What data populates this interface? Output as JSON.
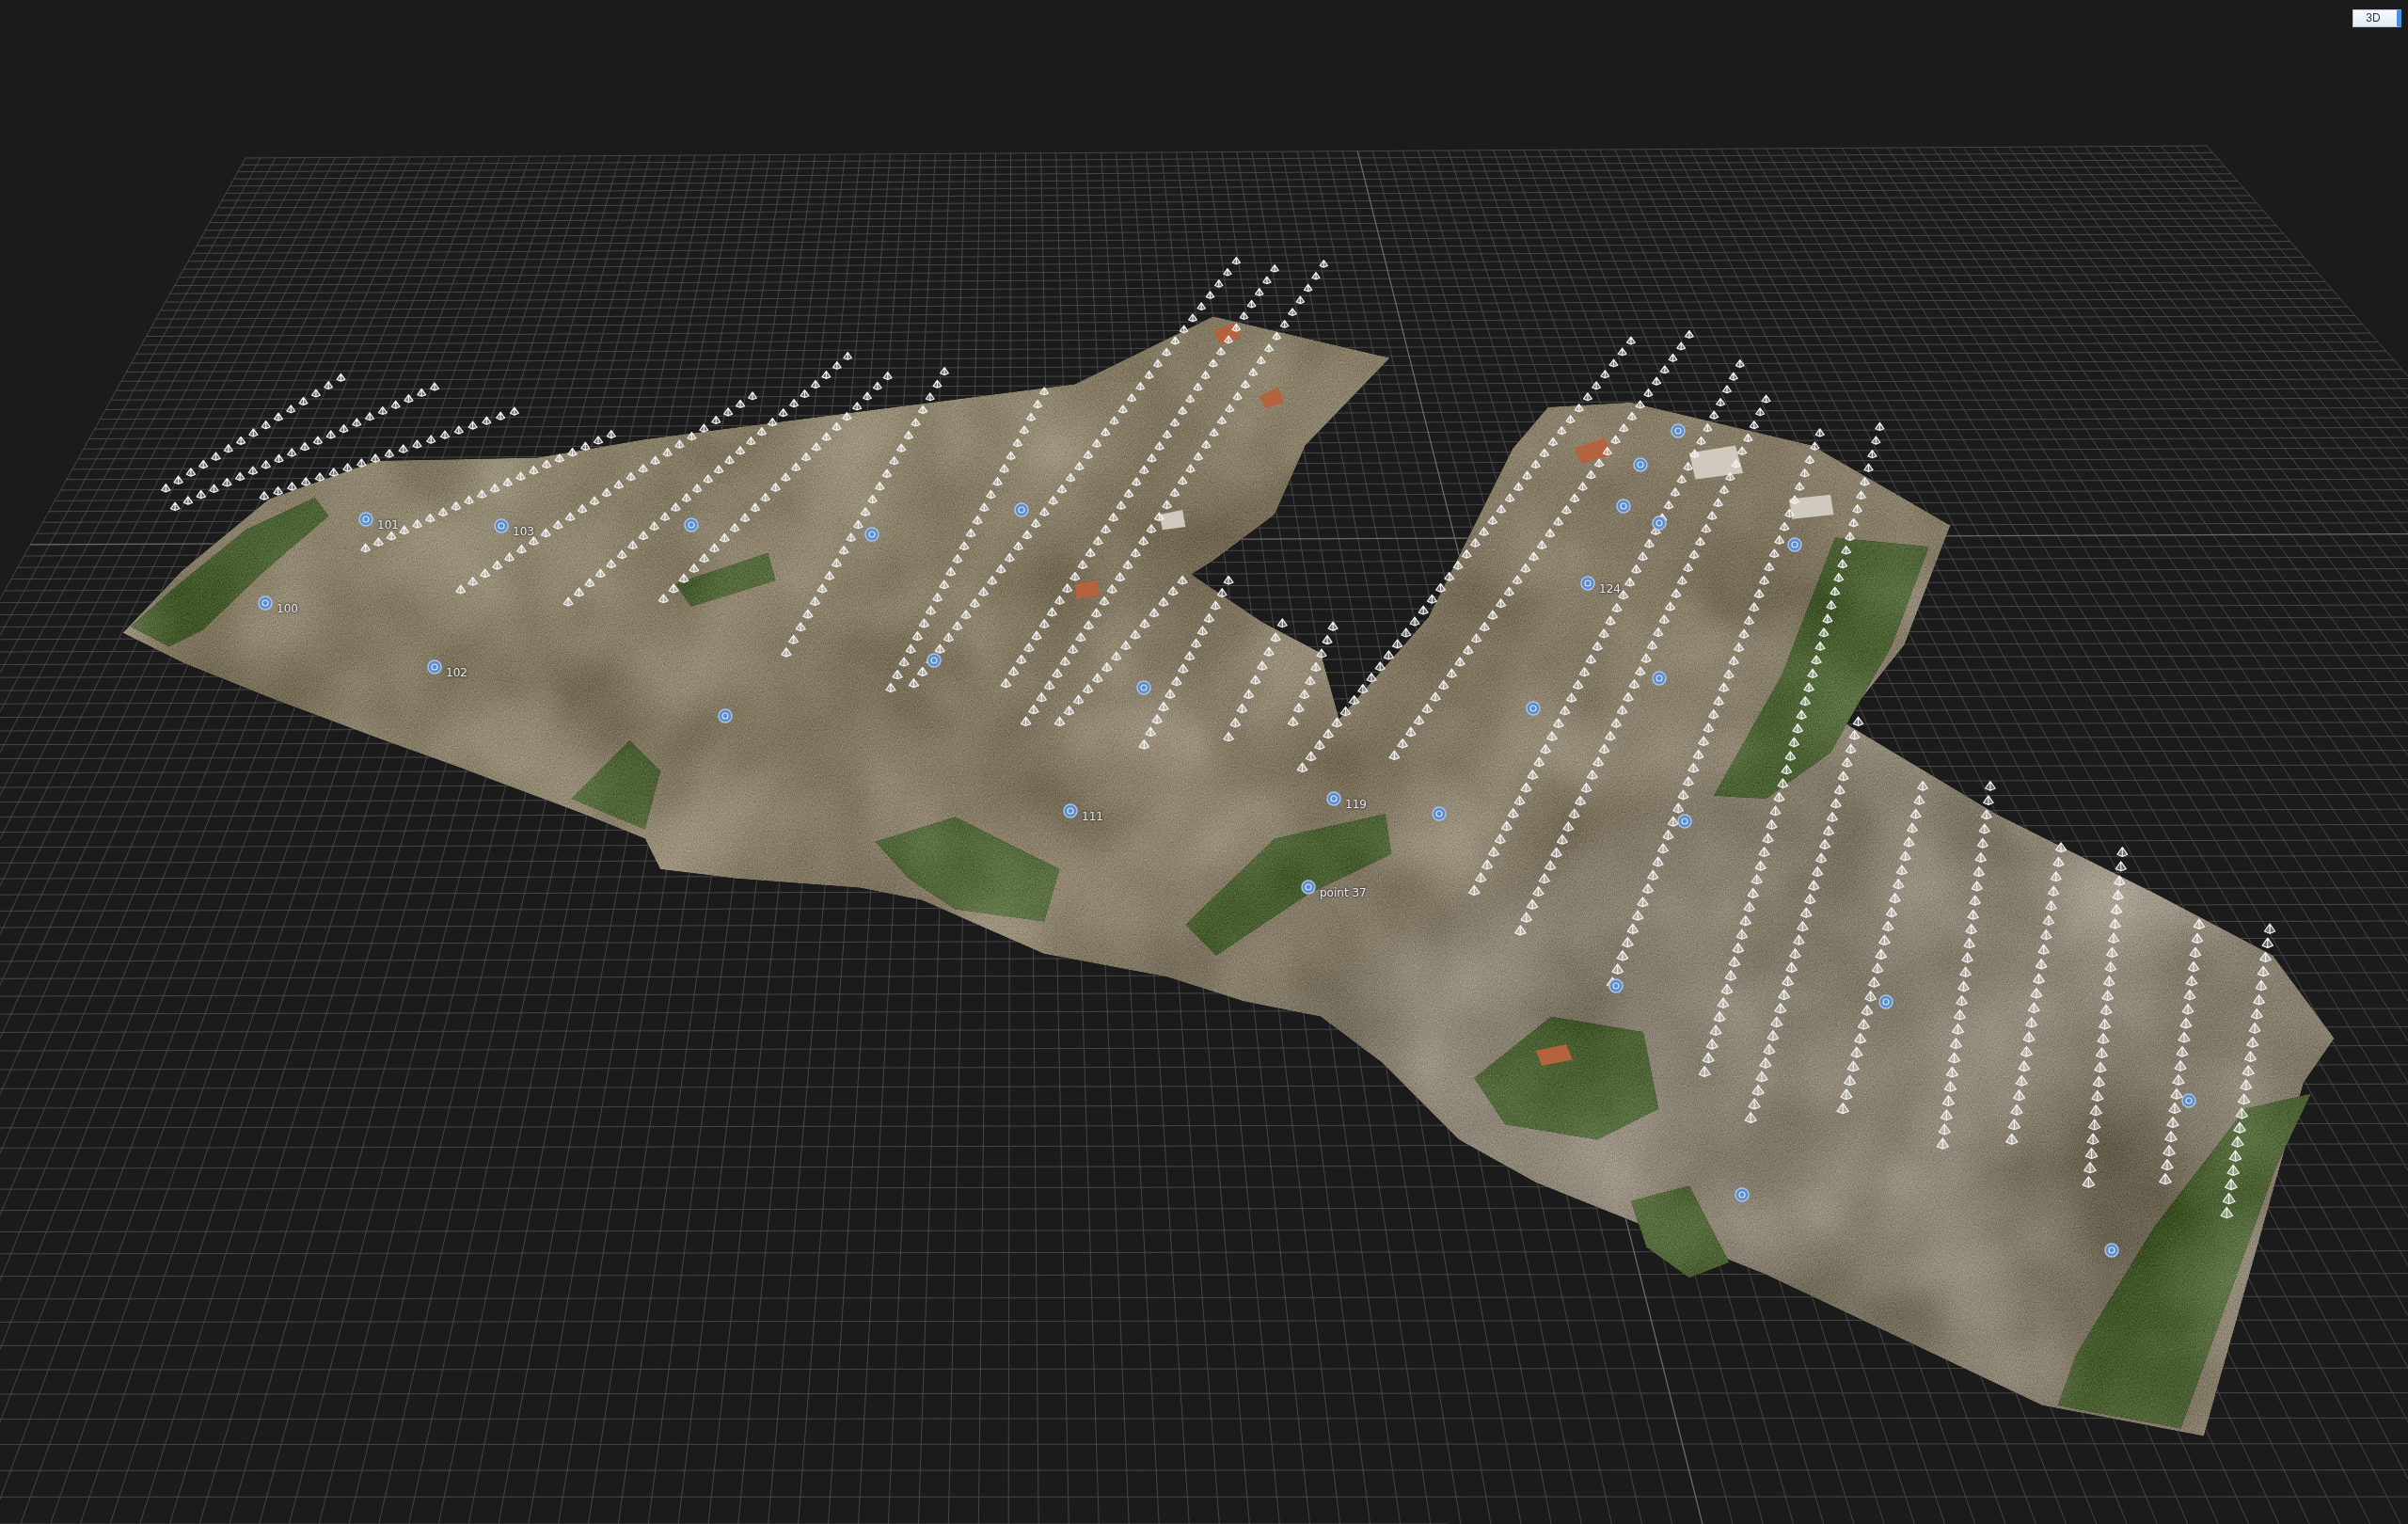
{
  "view_button": {
    "label": "3D"
  },
  "scene": {
    "markers": [
      {
        "label": "101"
      },
      {
        "label": "103"
      },
      {
        "label": "100"
      },
      {
        "label": "102"
      },
      {
        "label": "111"
      },
      {
        "label": "119"
      },
      {
        "label": "point 37"
      },
      {
        "label": "124"
      }
    ]
  }
}
